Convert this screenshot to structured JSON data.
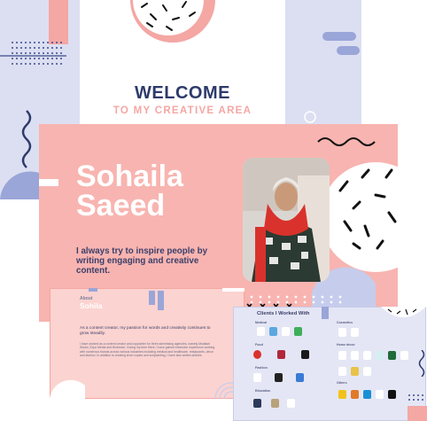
{
  "welcome": {
    "title": "WELCOME",
    "subtitle": "TO MY CREATIVE AREA"
  },
  "hero": {
    "first_name": "Sohaila",
    "last_name": "Saeed",
    "quote": "I always try to inspire people by writing engaging and creative content."
  },
  "bio": {
    "label": "About",
    "name": "Sohila",
    "text": "As a content creator, my passion for words and creativity continues to grow steadily.",
    "body": "I have worked as a content creator and copywriter for three advertising agencies, namely Modlash Studio, Expo Media and Brofusion. During my time there, I have gained extensive experience working with numerous brands across various industries including medical and healthcare, restaurants, decor and fashion. In addition to creating short copies and scriptwriting, I have also written articles."
  },
  "clients": {
    "title": "Clients I Worked With",
    "categories": [
      "Medical",
      "Food",
      "Fashion",
      "Education",
      "Cosmetics",
      "Home decor",
      "Others"
    ]
  },
  "colors": {
    "lavender": "#dcdff2",
    "pink": "#f8b4b0",
    "navy": "#2d3a6b",
    "accent_pink": "#f4a7a3"
  }
}
